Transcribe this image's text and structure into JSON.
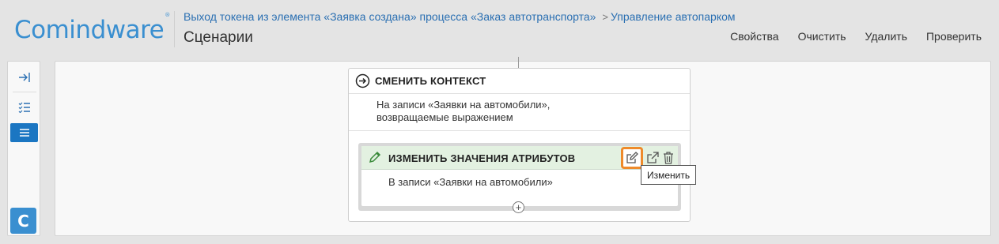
{
  "header": {
    "logo": "Comindware",
    "logo_mark": "®",
    "breadcrumbs": [
      "Выход токена из элемента «Заявка создана» процесса «Заказ автотранспорта»",
      "Управление автопарком"
    ],
    "breadcrumb_separator": ">",
    "title": "Сценарии",
    "actions": [
      "Свойства",
      "Очистить",
      "Удалить",
      "Проверить"
    ]
  },
  "sidebar": {
    "items": [
      {
        "icon": "collapse-right-icon"
      },
      {
        "icon": "checklist-icon"
      },
      {
        "icon": "list-icon",
        "active": true
      }
    ],
    "bottom_button": "C"
  },
  "scenario": {
    "outer_card": {
      "title": "СМЕНИТЬ КОНТЕКСТ",
      "description_lines": [
        "На записи «Заявки на автомобили»,",
        "возвращаемые выражением"
      ]
    },
    "inner_card": {
      "title": "ИЗМЕНИТЬ ЗНАЧЕНИЯ АТРИБУТОВ",
      "description": "В записи «Заявки на автомобили»"
    },
    "add_symbol": "+",
    "tooltip": "Изменить"
  },
  "colors": {
    "brand": "#3a8fd0",
    "link": "#2a6fb2",
    "active_side": "#1b76c2",
    "highlight": "#ee8a2a",
    "inner_header": "#e3f1e1"
  }
}
